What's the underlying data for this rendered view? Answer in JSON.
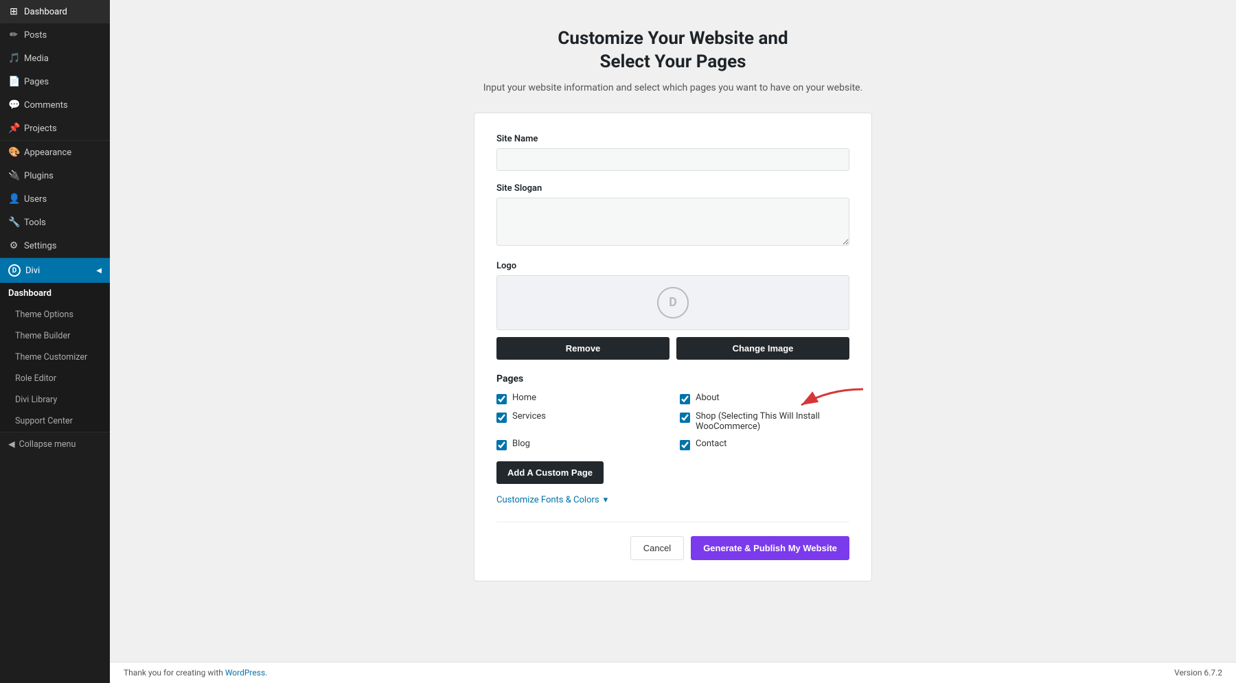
{
  "sidebar": {
    "items": [
      {
        "id": "dashboard",
        "label": "Dashboard",
        "icon": "⊞"
      },
      {
        "id": "posts",
        "label": "Posts",
        "icon": "📝"
      },
      {
        "id": "media",
        "label": "Media",
        "icon": "🎵"
      },
      {
        "id": "pages",
        "label": "Pages",
        "icon": "📄"
      },
      {
        "id": "comments",
        "label": "Comments",
        "icon": "💬"
      },
      {
        "id": "projects",
        "label": "Projects",
        "icon": "📌"
      },
      {
        "id": "appearance",
        "label": "Appearance",
        "icon": "🎨"
      },
      {
        "id": "plugins",
        "label": "Plugins",
        "icon": "🔌"
      },
      {
        "id": "users",
        "label": "Users",
        "icon": "👤"
      },
      {
        "id": "tools",
        "label": "Tools",
        "icon": "🔧"
      },
      {
        "id": "settings",
        "label": "Settings",
        "icon": "⚙"
      }
    ],
    "divi": {
      "label": "Divi",
      "submenu": [
        {
          "id": "divi-dashboard",
          "label": "Dashboard"
        },
        {
          "id": "theme-options",
          "label": "Theme Options"
        },
        {
          "id": "theme-builder",
          "label": "Theme Builder"
        },
        {
          "id": "theme-customizer",
          "label": "Theme Customizer"
        },
        {
          "id": "role-editor",
          "label": "Role Editor"
        },
        {
          "id": "divi-library",
          "label": "Divi Library"
        },
        {
          "id": "support-center",
          "label": "Support Center"
        }
      ]
    },
    "collapse_label": "Collapse menu"
  },
  "page": {
    "title_line1": "Customize Your Website and",
    "title_line2": "Select Your Pages",
    "subtitle": "Input your website information and select which pages you want to have on your website."
  },
  "form": {
    "site_name_label": "Site Name",
    "site_name_placeholder": "",
    "site_slogan_label": "Site Slogan",
    "site_slogan_placeholder": "",
    "logo_label": "Logo",
    "logo_letter": "D",
    "remove_button": "Remove",
    "change_image_button": "Change Image",
    "pages_label": "Pages",
    "pages": [
      {
        "id": "home",
        "label": "Home",
        "checked": true,
        "col": 0
      },
      {
        "id": "about",
        "label": "About",
        "checked": true,
        "col": 1
      },
      {
        "id": "services",
        "label": "Services",
        "checked": true,
        "col": 0
      },
      {
        "id": "shop",
        "label": "Shop (Selecting This Will Install WooCommerce)",
        "checked": true,
        "col": 1
      },
      {
        "id": "blog",
        "label": "Blog",
        "checked": true,
        "col": 0
      },
      {
        "id": "contact",
        "label": "Contact",
        "checked": true,
        "col": 1
      }
    ],
    "add_page_button": "Add A Custom Page",
    "customize_fonts_label": "Customize Fonts & Colors",
    "customize_fonts_arrow": "▾",
    "cancel_button": "Cancel",
    "publish_button": "Generate & Publish My Website"
  },
  "footer": {
    "left_text": "Thank you for creating with ",
    "wordpress_link": "WordPress.",
    "version": "Version 6.7.2"
  }
}
